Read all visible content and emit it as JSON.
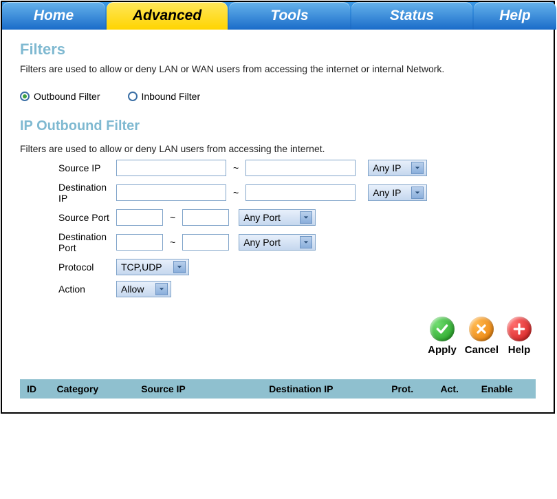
{
  "tabs": {
    "home": "Home",
    "advanced": "Advanced",
    "tools": "Tools",
    "status": "Status",
    "help": "Help"
  },
  "filters": {
    "title": "Filters",
    "desc": "Filters are used to allow or deny LAN or WAN users from accessing the internet or internal Network.",
    "radio_outbound": "Outbound Filter",
    "radio_inbound": "Inbound Filter"
  },
  "outbound": {
    "title": "IP Outbound Filter",
    "desc": "Filters are used to allow or deny LAN users from accessing the internet.",
    "labels": {
      "source_ip": "Source IP",
      "dest_ip": "Destination IP",
      "source_port": "Source Port",
      "dest_port": "Destination Port",
      "protocol": "Protocol",
      "action": "Action"
    },
    "selects": {
      "any_ip": "Any IP",
      "any_port": "Any Port",
      "protocol": "TCP,UDP",
      "action": "Allow"
    },
    "tilde": "~"
  },
  "buttons": {
    "apply": "Apply",
    "cancel": "Cancel",
    "help": "Help"
  },
  "table": {
    "id": "ID",
    "category": "Category",
    "source_ip": "Source IP",
    "dest_ip": "Destination IP",
    "prot": "Prot.",
    "act": "Act.",
    "enable": "Enable"
  }
}
